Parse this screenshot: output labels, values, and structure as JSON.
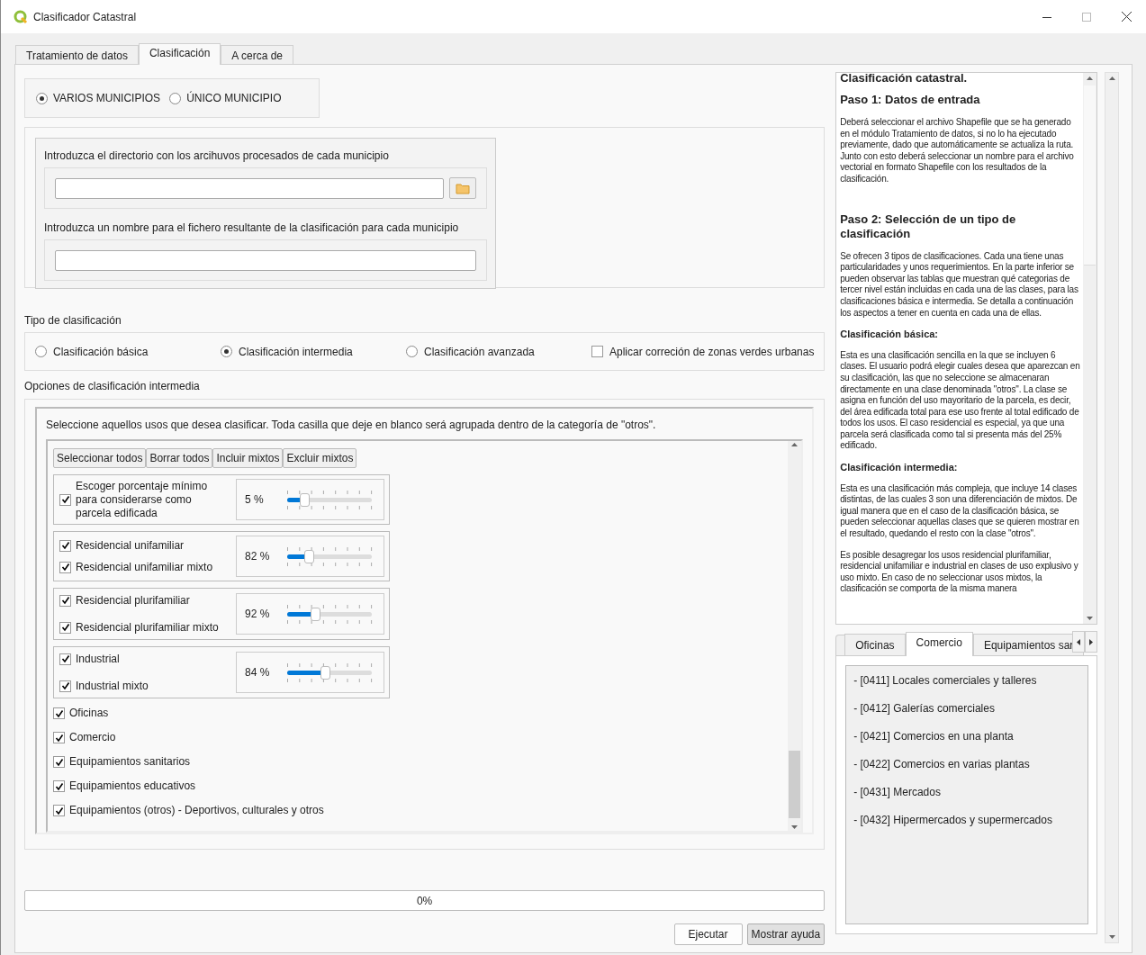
{
  "window": {
    "title": "Clasificador Catastral"
  },
  "tabs": [
    {
      "label": "Tratamiento de datos",
      "selected": false
    },
    {
      "label": "Clasificación",
      "selected": true
    },
    {
      "label": "A cerca de",
      "selected": false
    }
  ],
  "mode": [
    {
      "label": "VARIOS MUNICIPIOS",
      "selected": true
    },
    {
      "label": "ÚNICO MUNICIPIO",
      "selected": false
    }
  ],
  "inputs": [
    {
      "label": "Introduzca el directorio con los arcihuvos procesados de cada municipio",
      "kind": "folder"
    },
    {
      "label": "Introduzca un nombre para el fichero resultante de la clasificación para cada municipio",
      "kind": "text"
    }
  ],
  "classification_type": {
    "label": "Tipo de clasificación",
    "options": [
      {
        "label": "Clasificación básica",
        "kind": "radio",
        "selected": false
      },
      {
        "label": "Clasificación intermedia",
        "kind": "radio",
        "selected": true
      },
      {
        "label": "Clasificación avanzada",
        "kind": "radio",
        "selected": false
      },
      {
        "label": "Aplicar correción de zonas verdes urbanas",
        "kind": "checkbox",
        "selected": false
      }
    ]
  },
  "options": {
    "label": "Opciones de clasificación intermedia",
    "instructions": "Seleccione aquellos usos que desea clasificar. Toda casilla que deje en blanco será agrupada dentro de la categoría de \"otros\".",
    "actions": [
      "Seleccionar todos",
      "Borrar todos",
      "Incluir mixtos",
      "Excluir mixtos"
    ],
    "groups": [
      {
        "items": [
          {
            "label": "Escoger porcentaje mínimo para considerarse como parcela edificada",
            "checked": true
          }
        ],
        "slider": {
          "reading": "5 %",
          "level": 0.2
        }
      },
      {
        "items": [
          {
            "label": "Residencial unifamiliar",
            "checked": true
          },
          {
            "label": "Residencial unifamiliar mixto",
            "checked": true
          }
        ],
        "slider": {
          "reading": "82 %",
          "level": 0.26
        }
      },
      {
        "items": [
          {
            "label": "Residencial plurifamiliar",
            "checked": true
          },
          {
            "label": "Residencial plurifamiliar mixto",
            "checked": true
          }
        ],
        "slider": {
          "reading": "92 %",
          "level": 0.33
        }
      },
      {
        "items": [
          {
            "label": "Industrial",
            "checked": true
          },
          {
            "label": "Industrial mixto",
            "checked": true
          }
        ],
        "slider": {
          "reading": "84 %",
          "level": 0.45
        }
      }
    ],
    "items": [
      {
        "label": "Oficinas",
        "checked": true
      },
      {
        "label": "Comercio",
        "checked": true
      },
      {
        "label": "Equipamientos sanitarios",
        "checked": true
      },
      {
        "label": "Equipamientos educativos",
        "checked": true
      },
      {
        "label": "Equipamientos (otros) - Deportivos, culturales y otros",
        "checked": true
      }
    ]
  },
  "progress": {
    "reading": "0%"
  },
  "buttons": [
    {
      "label": "Ejecutar",
      "selected": false
    },
    {
      "label": "Mostrar ayuda",
      "selected": true
    }
  ],
  "help": [
    {
      "kind": "title",
      "text": "Clasificación catastral."
    },
    {
      "kind": "heading",
      "text": "Paso 1: Datos de entrada"
    },
    {
      "kind": "paragraph",
      "text": "Deberá seleccionar el archivo Shapefile que se ha generado en el módulo Tratamiento de datos, si no lo ha ejecutado previamente, dado que automáticamente se actualiza la ruta. Junto con esto deberá seleccionar un nombre para el archivo vectorial en formato Shapefile con los resultados de la clasificación."
    },
    {
      "kind": "heading",
      "text": "Paso 2: Selección de un tipo de clasificación"
    },
    {
      "kind": "paragraph",
      "text": "Se ofrecen 3 tipos de clasificaciones. Cada una tiene unas particularidades y unos requerimientos. En la parte inferior se pueden observar las tablas que muestran qué categorias de tercer nivel están incluidas en cada una de las clases, para las clasificaciones básica e intermedia. Se detalla a continuación los aspectos a tener en cuenta en cada una de ellas."
    },
    {
      "kind": "subheading",
      "text": "Clasificación básica:"
    },
    {
      "kind": "paragraph",
      "text": "Esta es una clasificación sencilla en la que se incluyen 6 clases. El usuario podrá elegir cuales desea que aparezcan en su clasificación, las que no seleccione se almacenaran directamente en una clase denominada \"otros\". La clase se asigna en función del uso mayoritario de la parcela, es decir, del área edificada total para ese uso frente al total edificado de todos los usos. El caso residencial es especial, ya que una parcela será clasificada como tal si presenta más del 25% edificado."
    },
    {
      "kind": "subheading",
      "text": "Clasificación intermedia:"
    },
    {
      "kind": "paragraph",
      "text": "Esta es una clasificación más compleja, que incluye 14 clases distintas, de las cuales 3 son una diferenciación de mixtos. De igual manera que en el caso de la clasificación básica, se pueden seleccionar aquellas clases que se quieren mostrar en el resultado, quedando el resto con la clase \"otros\"."
    },
    {
      "kind": "paragraph",
      "text": "Es posible desagregar los usos residencial plurifamiliar, residencial unifamiliar e industrial en clases de uso explusivo y uso mixto. En caso de no seleccionar usos mixtos, la clasificación se comporta de la misma manera"
    }
  ],
  "category_tabs": [
    {
      "label": "Oficinas",
      "selected": false
    },
    {
      "label": "Comercio",
      "selected": true
    },
    {
      "label": "Equipamientos sar",
      "selected": false
    }
  ],
  "category_items": [
    "- [0411] Locales comerciales y talleres",
    "- [0412] Galerías comerciales",
    "- [0421] Comercios en una planta",
    "- [0422] Comercios en varias plantas",
    "- [0431] Mercados",
    "- [0432] Hipermercados y supermercados"
  ]
}
